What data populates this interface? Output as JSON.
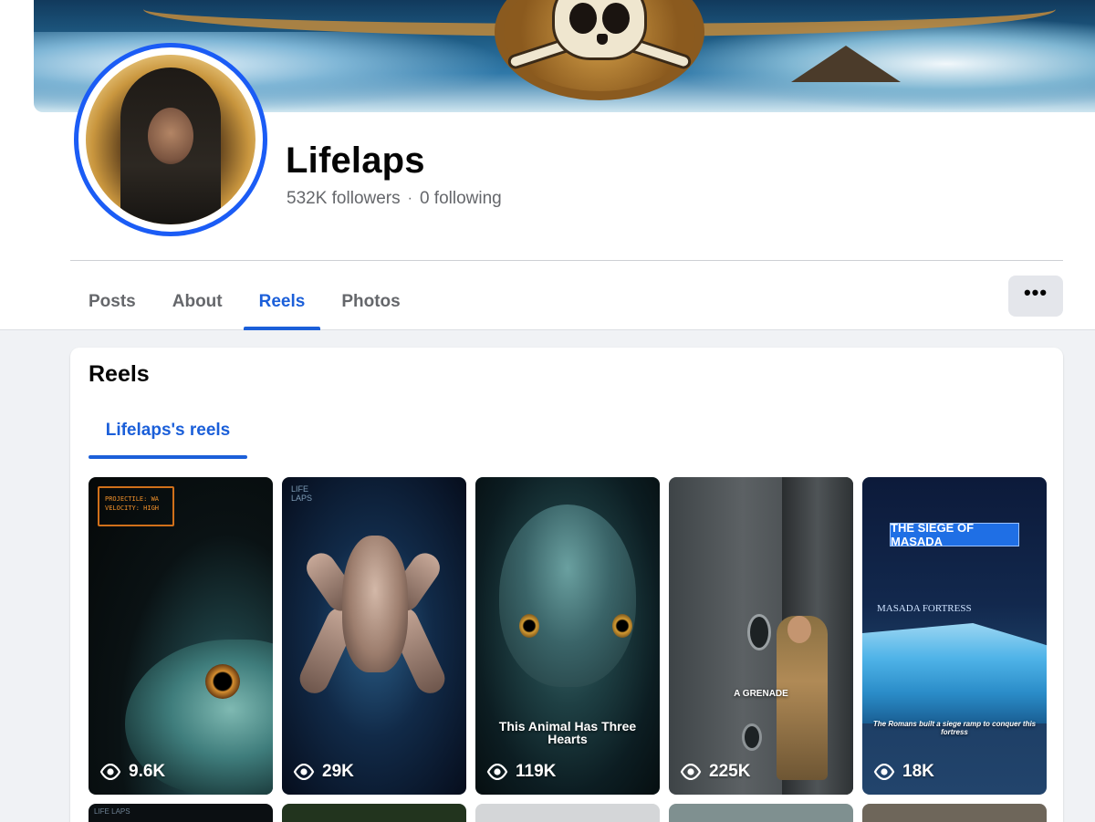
{
  "profile": {
    "name": "Lifelaps",
    "followers": "532K followers",
    "separator": "·",
    "following": "0 following"
  },
  "tabs": [
    {
      "label": "Posts",
      "active": false
    },
    {
      "label": "About",
      "active": false
    },
    {
      "label": "Reels",
      "active": true
    },
    {
      "label": "Photos",
      "active": false
    }
  ],
  "more_button": {
    "label": "•••",
    "icon": "more-horizontal-icon"
  },
  "reels_section": {
    "title": "Reels",
    "subtab": "Lifelaps's reels",
    "items": [
      {
        "views": "9.6K",
        "caption": "",
        "overlay": "PROJECTILE: WA\nVELOCITY: HIGH"
      },
      {
        "views": "29K",
        "caption": "",
        "overlay": "LIFE\nLAPS"
      },
      {
        "views": "119K",
        "caption": "This Animal Has Three Hearts",
        "overlay": ""
      },
      {
        "views": "225K",
        "caption": "A GRENADE",
        "overlay": ""
      },
      {
        "views": "18K",
        "caption": "The Romans built a siege ramp to conquer this fortress",
        "overlay": "THE SIEGE OF MASADA",
        "label": "MASADA FORTRESS"
      }
    ],
    "row2_overlay": "LIFE LAPS"
  },
  "colors": {
    "accent": "#1b5fd9",
    "avatar_ring": "#1b5cf5",
    "muted_text": "#65676b",
    "page_bg": "#f0f2f5"
  }
}
